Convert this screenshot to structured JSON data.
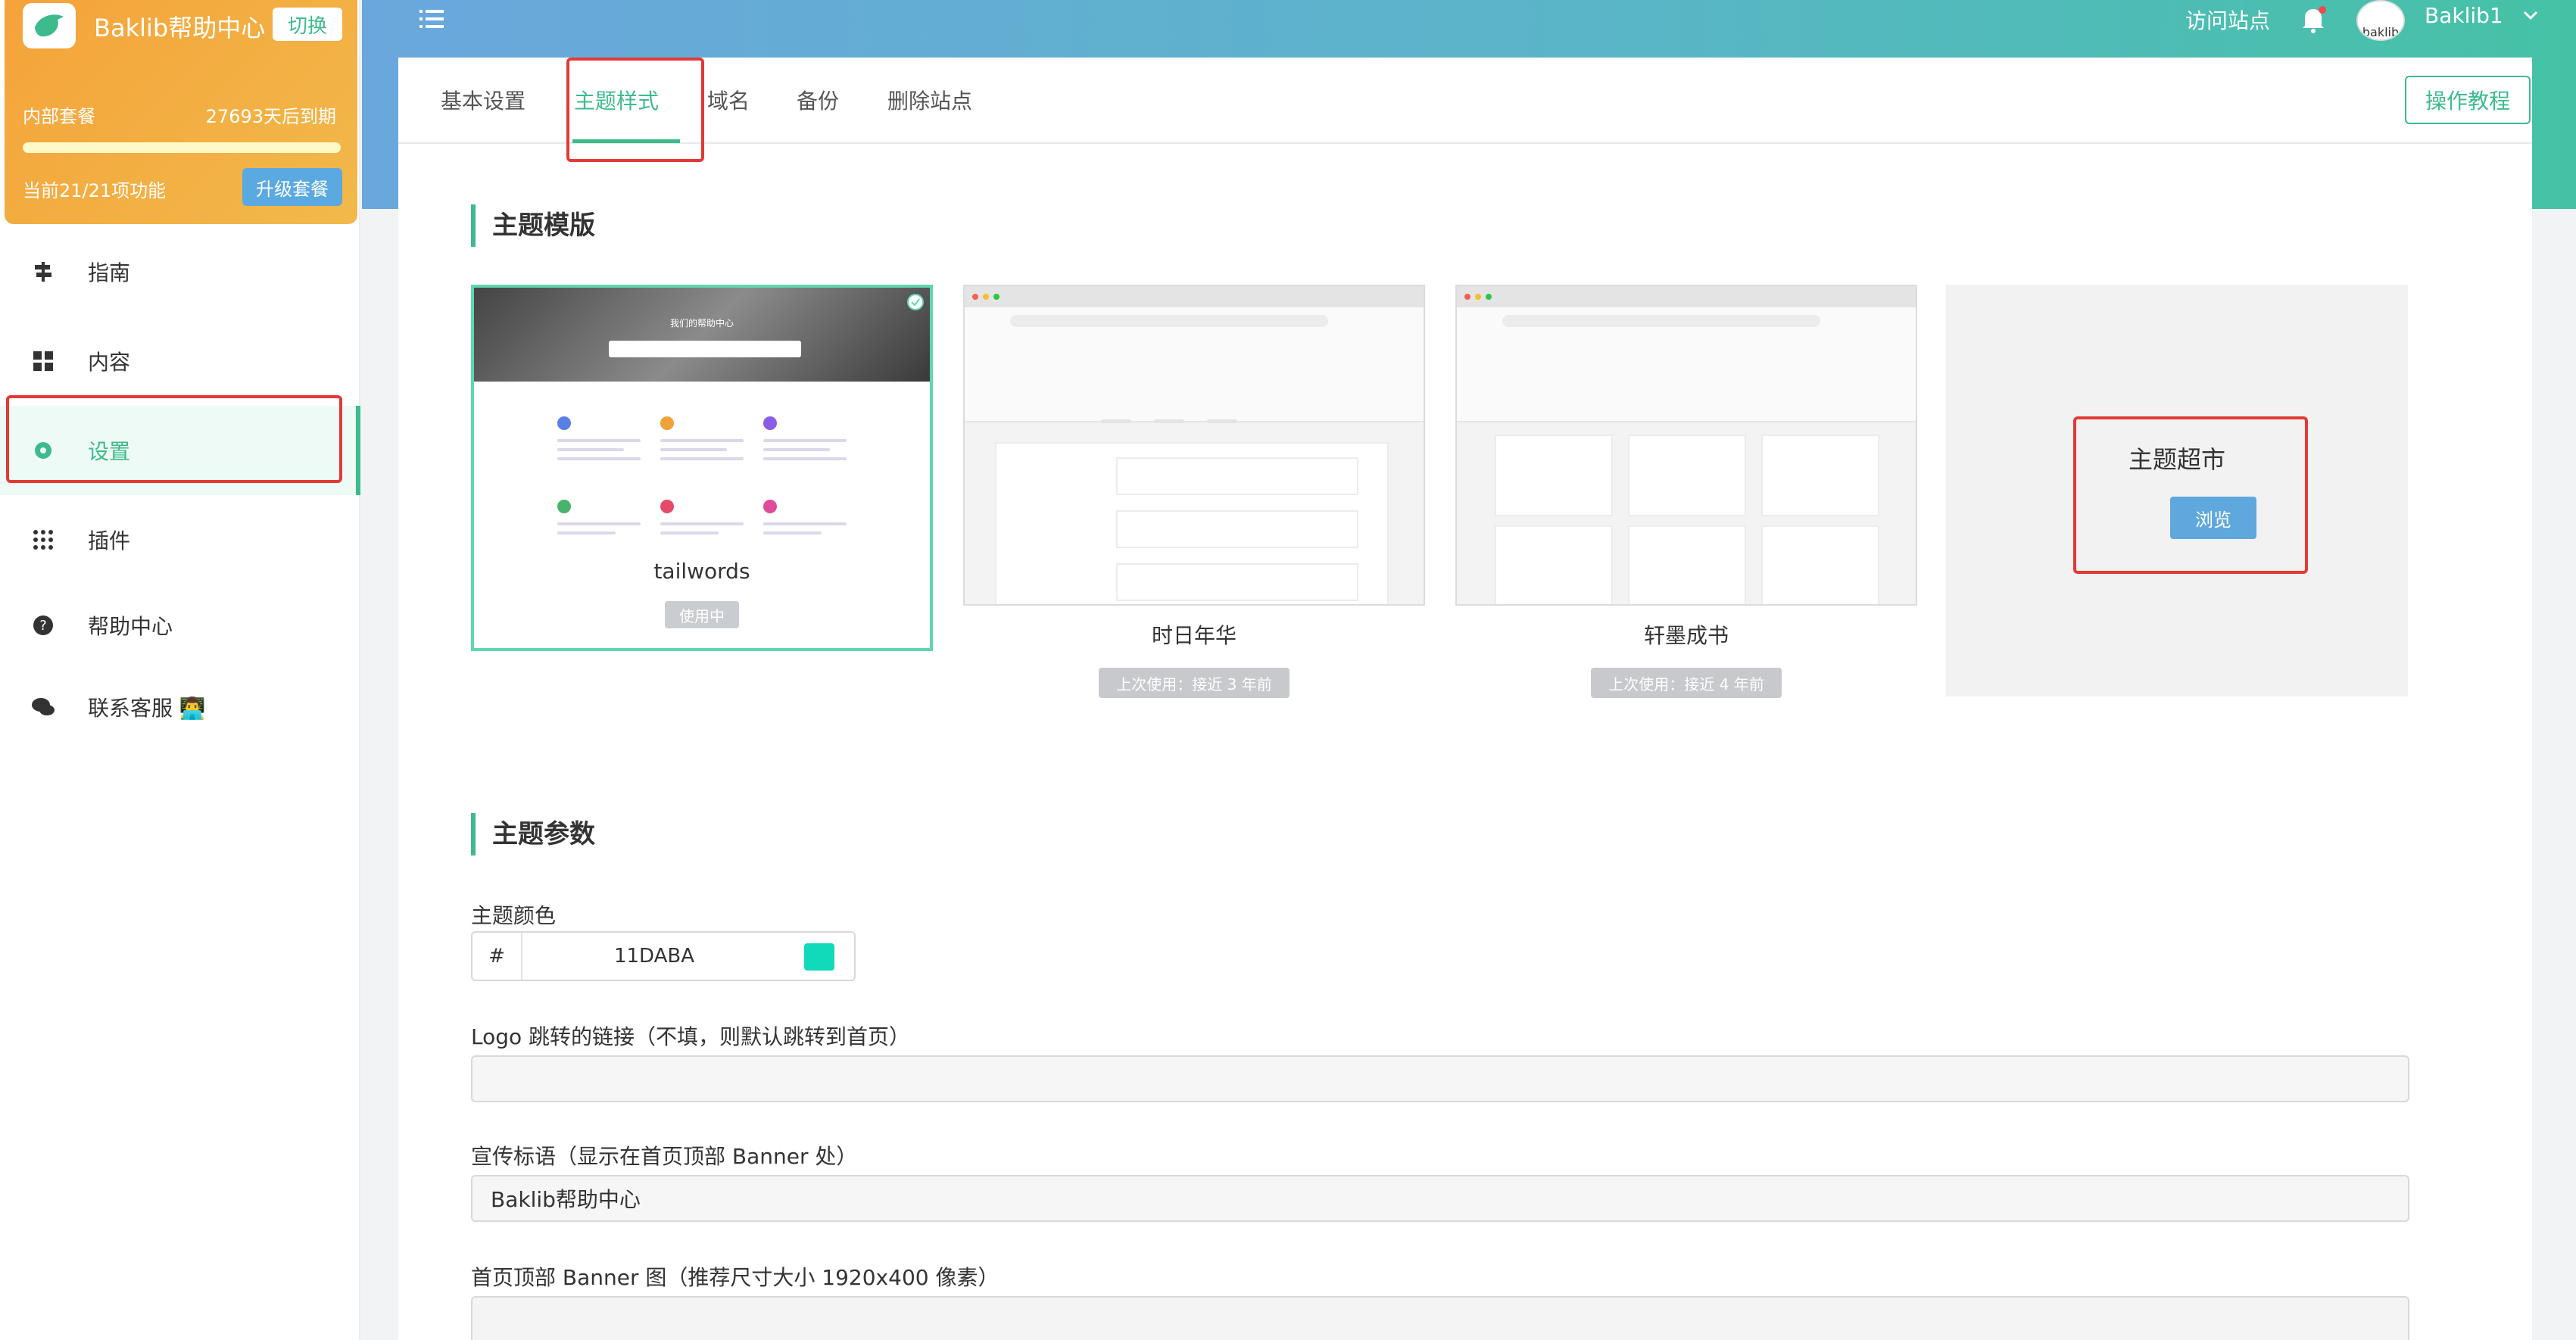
{
  "brand": {
    "title": "Baklib帮助中心",
    "switch_label": "切换",
    "plan_name": "内部套餐",
    "plan_expire": "27693天后到期",
    "plan_usage": "当前21/21项功能",
    "plan_progress_fraction": 1.0,
    "upgrade_label": "升级套餐"
  },
  "sidebar": {
    "items": [
      {
        "label": "指南",
        "icon": "signpost-icon"
      },
      {
        "label": "内容",
        "icon": "grid-icon"
      },
      {
        "label": "设置",
        "icon": "gear-icon",
        "active": true
      },
      {
        "label": "插件",
        "icon": "apps-icon"
      },
      {
        "label": "帮助中心",
        "icon": "question-icon"
      },
      {
        "label": "联系客服 👨‍💻",
        "icon": "chat-icon"
      }
    ]
  },
  "topbar": {
    "visit_site": "访问站点",
    "username": "Baklib1",
    "avatar_text": "baklib"
  },
  "tabs": [
    {
      "label": "基本设置"
    },
    {
      "label": "主题样式",
      "active": true
    },
    {
      "label": "域名"
    },
    {
      "label": "备份"
    },
    {
      "label": "删除站点"
    }
  ],
  "tutorial_label": "操作教程",
  "theme_section": {
    "title": "主题模版",
    "themes": [
      {
        "name": "tailwords",
        "status": "使用中",
        "hero_title": "我们的帮助中心"
      },
      {
        "name": "时日年华",
        "status": "上次使用：接近 3 年前",
        "url": "https://baklib.com"
      },
      {
        "name": "轩墨成书",
        "status": "上次使用：接近 4 年前",
        "url": "https://baklib.com"
      }
    ],
    "market": {
      "title": "主题超市",
      "browse_label": "浏览"
    }
  },
  "params_section": {
    "title": "主题参数",
    "color_label": "主题颜色",
    "color_prefix": "#",
    "color_value": "11DABA",
    "logo_link_label": "Logo 跳转的链接（不填，则默认跳转到首页）",
    "logo_link_value": "",
    "slogan_label": "宣传标语（显示在首页顶部 Banner 处）",
    "slogan_value": "Baklib帮助中心",
    "banner_label": "首页顶部 Banner 图（推荐尺寸大小 1920x400 像素）"
  },
  "colors": {
    "accent": "#3dbb8c",
    "theme_color": "#11DABA",
    "brand_gradient_start": "#f4a33a",
    "topbar_gradient_end": "#45c2a6",
    "highlight_red": "#e53935"
  }
}
